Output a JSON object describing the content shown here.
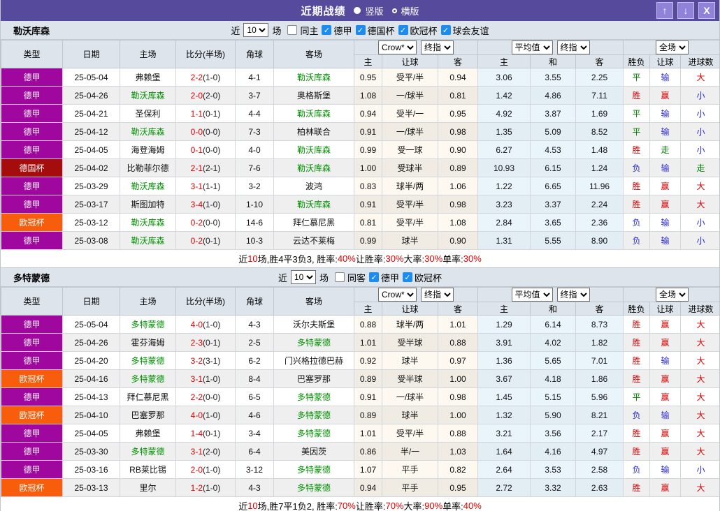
{
  "titlebar": {
    "title": "近期战绩",
    "radio_vertical": "竖版",
    "radio_horizontal": "横版",
    "buttons": {
      "up": "↑",
      "down": "↓",
      "close": "X"
    }
  },
  "colors": {
    "accent_purple": "#564a9c",
    "check_blue": "#1d8cf0",
    "badge": {
      "德甲": "#a0079f",
      "德国杯": "#a50d0d",
      "欧冠杯": "#f75d0b"
    }
  },
  "table_columns": {
    "main": [
      "类型",
      "日期",
      "主场",
      "比分(半场)",
      "角球",
      "客场"
    ],
    "sub": [
      "主",
      "让球",
      "客",
      "主",
      "和",
      "客",
      "胜负",
      "让球",
      "进球数"
    ],
    "dropdown_crow": "Crow*",
    "dropdown_final1": "终指",
    "dropdown_avg": "平均值",
    "dropdown_final2": "终指",
    "dropdown_fulltime": "全场"
  },
  "sections": [
    {
      "team": "勒沃库森",
      "filter": {
        "prefix": "近",
        "count": "10",
        "suffix": "场",
        "same_venue_label": "同主",
        "same_venue_checked": false,
        "leagues": [
          {
            "label": "德甲",
            "checked": true
          },
          {
            "label": "德国杯",
            "checked": true
          },
          {
            "label": "欧冠杯",
            "checked": true
          },
          {
            "label": "球会友谊",
            "checked": true
          }
        ]
      },
      "rows": [
        {
          "type": "德甲",
          "date": "25-05-04",
          "home": "弗赖堡",
          "home_focus": false,
          "score": "2-2",
          "half": "(1-0)",
          "corners": "4-1",
          "away": "勒沃库森",
          "away_focus": true,
          "hcap_home": "0.95",
          "hcap_line": "受平/半",
          "hcap_away": "0.94",
          "avg_home": "3.06",
          "avg_draw": "3.55",
          "avg_away": "2.25",
          "outcome": "平",
          "hcap_result": "输",
          "goals": "大"
        },
        {
          "type": "德甲",
          "date": "25-04-26",
          "home": "勒沃库森",
          "home_focus": true,
          "score": "2-0",
          "half": "(2-0)",
          "corners": "3-7",
          "away": "奥格斯堡",
          "away_focus": false,
          "hcap_home": "1.08",
          "hcap_line": "一/球半",
          "hcap_away": "0.81",
          "avg_home": "1.42",
          "avg_draw": "4.86",
          "avg_away": "7.11",
          "outcome": "胜",
          "hcap_result": "赢",
          "goals": "小"
        },
        {
          "type": "德甲",
          "date": "25-04-21",
          "home": "圣保利",
          "home_focus": false,
          "score": "1-1",
          "half": "(0-1)",
          "corners": "4-4",
          "away": "勒沃库森",
          "away_focus": true,
          "hcap_home": "0.94",
          "hcap_line": "受半/一",
          "hcap_away": "0.95",
          "avg_home": "4.92",
          "avg_draw": "3.87",
          "avg_away": "1.69",
          "outcome": "平",
          "hcap_result": "输",
          "goals": "小"
        },
        {
          "type": "德甲",
          "date": "25-04-12",
          "home": "勒沃库森",
          "home_focus": true,
          "score": "0-0",
          "half": "(0-0)",
          "corners": "7-3",
          "away": "柏林联合",
          "away_focus": false,
          "hcap_home": "0.91",
          "hcap_line": "一/球半",
          "hcap_away": "0.98",
          "avg_home": "1.35",
          "avg_draw": "5.09",
          "avg_away": "8.52",
          "outcome": "平",
          "hcap_result": "输",
          "goals": "小"
        },
        {
          "type": "德甲",
          "date": "25-04-05",
          "home": "海登海姆",
          "home_focus": false,
          "score": "0-1",
          "half": "(0-0)",
          "corners": "4-0",
          "away": "勒沃库森",
          "away_focus": true,
          "hcap_home": "0.99",
          "hcap_line": "受一球",
          "hcap_away": "0.90",
          "avg_home": "6.27",
          "avg_draw": "4.53",
          "avg_away": "1.48",
          "outcome": "胜",
          "hcap_result": "走",
          "goals": "小"
        },
        {
          "type": "德国杯",
          "date": "25-04-02",
          "home": "比勒菲尔德",
          "home_focus": false,
          "score": "2-1",
          "half": "(2-1)",
          "corners": "7-6",
          "away": "勒沃库森",
          "away_focus": true,
          "hcap_home": "1.00",
          "hcap_line": "受球半",
          "hcap_away": "0.89",
          "avg_home": "10.93",
          "avg_draw": "6.15",
          "avg_away": "1.24",
          "outcome": "负",
          "hcap_result": "输",
          "goals": "走"
        },
        {
          "type": "德甲",
          "date": "25-03-29",
          "home": "勒沃库森",
          "home_focus": true,
          "score": "3-1",
          "half": "(1-1)",
          "corners": "3-2",
          "away": "波鸿",
          "away_focus": false,
          "hcap_home": "0.83",
          "hcap_line": "球半/两",
          "hcap_away": "1.06",
          "avg_home": "1.22",
          "avg_draw": "6.65",
          "avg_away": "11.96",
          "outcome": "胜",
          "hcap_result": "赢",
          "goals": "大"
        },
        {
          "type": "德甲",
          "date": "25-03-17",
          "home": "斯图加特",
          "home_focus": false,
          "score": "3-4",
          "half": "(1-0)",
          "corners": "1-10",
          "away": "勒沃库森",
          "away_focus": true,
          "hcap_home": "0.91",
          "hcap_line": "受平/半",
          "hcap_away": "0.98",
          "avg_home": "3.23",
          "avg_draw": "3.37",
          "avg_away": "2.24",
          "outcome": "胜",
          "hcap_result": "赢",
          "goals": "大"
        },
        {
          "type": "欧冠杯",
          "date": "25-03-12",
          "home": "勒沃库森",
          "home_focus": true,
          "score": "0-2",
          "half": "(0-0)",
          "corners": "14-6",
          "away": "拜仁慕尼黑",
          "away_focus": false,
          "hcap_home": "0.81",
          "hcap_line": "受平/半",
          "hcap_away": "1.08",
          "avg_home": "2.84",
          "avg_draw": "3.65",
          "avg_away": "2.36",
          "outcome": "负",
          "hcap_result": "输",
          "goals": "小"
        },
        {
          "type": "德甲",
          "date": "25-03-08",
          "home": "勒沃库森",
          "home_focus": true,
          "score": "0-2",
          "half": "(0-1)",
          "corners": "10-3",
          "away": "云达不莱梅",
          "away_focus": false,
          "hcap_home": "0.99",
          "hcap_line": "球半",
          "hcap_away": "0.90",
          "avg_home": "1.31",
          "avg_draw": "5.55",
          "avg_away": "8.90",
          "outcome": "负",
          "hcap_result": "输",
          "goals": "小"
        }
      ],
      "summary": [
        {
          "text": "近"
        },
        {
          "text": "10",
          "red": true
        },
        {
          "text": "场,胜4平3负3, 胜率:"
        },
        {
          "text": "40%",
          "red": true
        },
        {
          "text": " 让胜率:"
        },
        {
          "text": "30%",
          "red": true
        },
        {
          "text": " 大率:"
        },
        {
          "text": "30%",
          "red": true
        },
        {
          "text": " 单率:"
        },
        {
          "text": "30%",
          "red": true
        }
      ]
    },
    {
      "team": "多特蒙德",
      "filter": {
        "prefix": "近",
        "count": "10",
        "suffix": "场",
        "same_venue_label": "同客",
        "same_venue_checked": false,
        "leagues": [
          {
            "label": "德甲",
            "checked": true
          },
          {
            "label": "欧冠杯",
            "checked": true
          }
        ]
      },
      "rows": [
        {
          "type": "德甲",
          "date": "25-05-04",
          "home": "多特蒙德",
          "home_focus": true,
          "score": "4-0",
          "half": "(1-0)",
          "corners": "4-3",
          "away": "沃尔夫斯堡",
          "away_focus": false,
          "hcap_home": "0.88",
          "hcap_line": "球半/两",
          "hcap_away": "1.01",
          "avg_home": "1.29",
          "avg_draw": "6.14",
          "avg_away": "8.73",
          "outcome": "胜",
          "hcap_result": "赢",
          "goals": "大"
        },
        {
          "type": "德甲",
          "date": "25-04-26",
          "home": "霍芬海姆",
          "home_focus": false,
          "score": "2-3",
          "half": "(0-1)",
          "corners": "2-5",
          "away": "多特蒙德",
          "away_focus": true,
          "hcap_home": "1.01",
          "hcap_line": "受半球",
          "hcap_away": "0.88",
          "avg_home": "3.91",
          "avg_draw": "4.02",
          "avg_away": "1.82",
          "outcome": "胜",
          "hcap_result": "赢",
          "goals": "大"
        },
        {
          "type": "德甲",
          "date": "25-04-20",
          "home": "多特蒙德",
          "home_focus": true,
          "score": "3-2",
          "half": "(3-1)",
          "corners": "6-2",
          "away": "门兴格拉德巴赫",
          "away_focus": false,
          "hcap_home": "0.92",
          "hcap_line": "球半",
          "hcap_away": "0.97",
          "avg_home": "1.36",
          "avg_draw": "5.65",
          "avg_away": "7.01",
          "outcome": "胜",
          "hcap_result": "输",
          "goals": "大"
        },
        {
          "type": "欧冠杯",
          "date": "25-04-16",
          "home": "多特蒙德",
          "home_focus": true,
          "score": "3-1",
          "half": "(1-0)",
          "corners": "8-4",
          "away": "巴塞罗那",
          "away_focus": false,
          "hcap_home": "0.89",
          "hcap_line": "受半球",
          "hcap_away": "1.00",
          "avg_home": "3.67",
          "avg_draw": "4.18",
          "avg_away": "1.86",
          "outcome": "胜",
          "hcap_result": "赢",
          "goals": "大"
        },
        {
          "type": "德甲",
          "date": "25-04-13",
          "home": "拜仁慕尼黑",
          "home_focus": false,
          "score": "2-2",
          "half": "(0-0)",
          "corners": "6-5",
          "away": "多特蒙德",
          "away_focus": true,
          "hcap_home": "0.91",
          "hcap_line": "一/球半",
          "hcap_away": "0.98",
          "avg_home": "1.45",
          "avg_draw": "5.15",
          "avg_away": "5.96",
          "outcome": "平",
          "hcap_result": "赢",
          "goals": "大"
        },
        {
          "type": "欧冠杯",
          "date": "25-04-10",
          "home": "巴塞罗那",
          "home_focus": false,
          "score": "4-0",
          "half": "(1-0)",
          "corners": "4-6",
          "away": "多特蒙德",
          "away_focus": true,
          "hcap_home": "0.89",
          "hcap_line": "球半",
          "hcap_away": "1.00",
          "avg_home": "1.32",
          "avg_draw": "5.90",
          "avg_away": "8.21",
          "outcome": "负",
          "hcap_result": "输",
          "goals": "大"
        },
        {
          "type": "德甲",
          "date": "25-04-05",
          "home": "弗赖堡",
          "home_focus": false,
          "score": "1-4",
          "half": "(0-1)",
          "corners": "3-4",
          "away": "多特蒙德",
          "away_focus": true,
          "hcap_home": "1.01",
          "hcap_line": "受平/半",
          "hcap_away": "0.88",
          "avg_home": "3.21",
          "avg_draw": "3.56",
          "avg_away": "2.17",
          "outcome": "胜",
          "hcap_result": "赢",
          "goals": "大"
        },
        {
          "type": "德甲",
          "date": "25-03-30",
          "home": "多特蒙德",
          "home_focus": true,
          "score": "3-1",
          "half": "(2-0)",
          "corners": "6-4",
          "away": "美因茨",
          "away_focus": false,
          "hcap_home": "0.86",
          "hcap_line": "半/一",
          "hcap_away": "1.03",
          "avg_home": "1.64",
          "avg_draw": "4.16",
          "avg_away": "4.97",
          "outcome": "胜",
          "hcap_result": "赢",
          "goals": "大"
        },
        {
          "type": "德甲",
          "date": "25-03-16",
          "home": "RB莱比锡",
          "home_focus": false,
          "score": "2-0",
          "half": "(1-0)",
          "corners": "3-12",
          "away": "多特蒙德",
          "away_focus": true,
          "hcap_home": "1.07",
          "hcap_line": "平手",
          "hcap_away": "0.82",
          "avg_home": "2.64",
          "avg_draw": "3.53",
          "avg_away": "2.58",
          "outcome": "负",
          "hcap_result": "输",
          "goals": "小"
        },
        {
          "type": "欧冠杯",
          "date": "25-03-13",
          "home": "里尔",
          "home_focus": false,
          "score": "1-2",
          "half": "(1-0)",
          "corners": "4-3",
          "away": "多特蒙德",
          "away_focus": true,
          "hcap_home": "0.94",
          "hcap_line": "平手",
          "hcap_away": "0.95",
          "avg_home": "2.72",
          "avg_draw": "3.32",
          "avg_away": "2.63",
          "outcome": "胜",
          "hcap_result": "赢",
          "goals": "大"
        }
      ],
      "summary": [
        {
          "text": "近"
        },
        {
          "text": "10",
          "red": true
        },
        {
          "text": "场,胜7平1负2, 胜率:"
        },
        {
          "text": "70%",
          "red": true
        },
        {
          "text": " 让胜率:"
        },
        {
          "text": "70%",
          "red": true
        },
        {
          "text": " 大率:"
        },
        {
          "text": "90%",
          "red": true
        },
        {
          "text": " 单率:"
        },
        {
          "text": "40%",
          "red": true
        }
      ]
    }
  ]
}
